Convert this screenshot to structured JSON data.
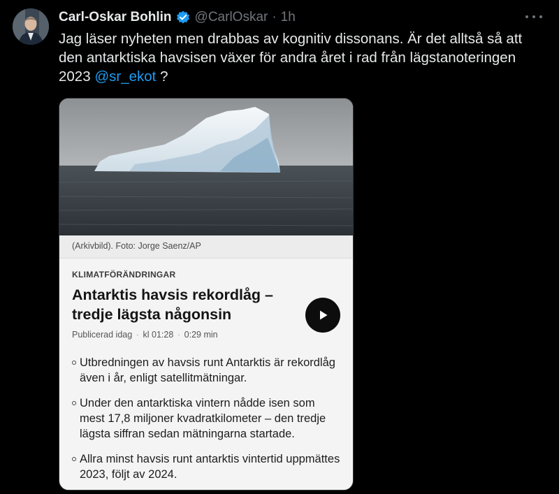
{
  "tweet": {
    "author_name": "Carl-Oskar Bohlin",
    "handle": "@CarlOskar",
    "separator": "·",
    "time": "1h",
    "text": "Jag läser nyheten men drabbas av kognitiv dissonans. Är det alltså så att den antarktiska havsisen växer för andra året i rad från lägstanoteringen 2023",
    "mention": "@sr_ekot",
    "text_end": "?"
  },
  "card": {
    "photo_caption": "(Arkivbild). Foto: Jorge Saenz/AP",
    "kicker": "KLIMATFÖRÄNDRINGAR",
    "headline": "Antarktis havsis rekordlåg – tredje lägsta någonsin",
    "meta": {
      "published": "Publicerad idag",
      "time": "kl 01:28",
      "duration": "0:29 min",
      "separator": "·"
    },
    "bullets": [
      "Utbredningen av havsis runt Antarktis är rekordlåg även i år, enligt satellitmätningar.",
      "Under den antarktiska vintern nådde isen som mest 17,8 miljoner kvadratkilometer – den tredje lägsta siffran sedan mätningarna startade.",
      "Allra minst havsis runt antarktis vintertid uppmättes 2023, följt av 2024."
    ]
  },
  "icons": {
    "verified": "verified-badge-icon",
    "more": "more-options-icon",
    "play": "play-icon"
  },
  "colors": {
    "background": "#000000",
    "text": "#e7e9ea",
    "secondary": "#71767b",
    "accent": "#1d9bf0"
  }
}
